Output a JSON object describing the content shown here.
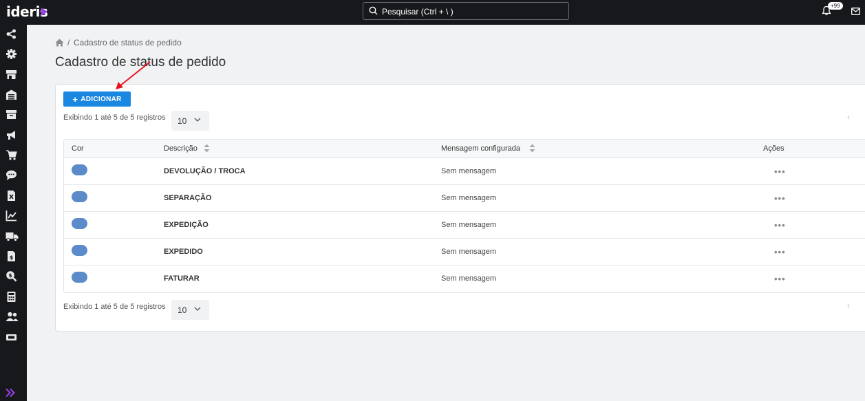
{
  "app": {
    "logo_text": "ideris",
    "search_placeholder": "Pesquisar (Ctrl + \\ )",
    "notifications_badge": "+99",
    "brand_color": "#9b3fe8"
  },
  "sidebar": {
    "icons": [
      "share-icon",
      "gear-icon",
      "store-icon",
      "warehouse-icon",
      "archive-icon",
      "megaphone-icon",
      "cart-icon",
      "chat-icon",
      "excel-file-icon",
      "chart-line-icon",
      "truck-icon",
      "invoice-icon",
      "search-dollar-icon",
      "calculator-icon",
      "users-icon",
      "ticket-icon"
    ],
    "expand_icon": "double-chevron-right-icon"
  },
  "breadcrumb": {
    "separator": "/",
    "current": "Cadastro de status de pedido"
  },
  "page": {
    "title": "Cadastro de status de pedido",
    "add_button": "ADICIONAR",
    "accent_color": "#1a88e0"
  },
  "listing": {
    "showing_top": "Exibindo 1 até 5 de 5 registros",
    "showing_bottom": "Exibindo 1 até 5 de 5 registros",
    "page_size": "10"
  },
  "table": {
    "headers": {
      "color": "Cor",
      "description": "Descrição",
      "message": "Mensagem configurada",
      "actions": "Ações"
    },
    "rows": [
      {
        "color": "#5b8bc9",
        "description": "DEVOLUÇÃO / TROCA",
        "message": "Sem mensagem",
        "actions": "•••"
      },
      {
        "color": "#5b8bc9",
        "description": "SEPARAÇÃO",
        "message": "Sem mensagem",
        "actions": "•••"
      },
      {
        "color": "#5b8bc9",
        "description": "EXPEDIÇÃO",
        "message": "Sem mensagem",
        "actions": "•••"
      },
      {
        "color": "#5b8bc9",
        "description": "EXPEDIDO",
        "message": "Sem mensagem",
        "actions": "•••"
      },
      {
        "color": "#5b8bc9",
        "description": "FATURAR",
        "message": "Sem mensagem",
        "actions": "•••"
      }
    ]
  },
  "pager": {
    "prev": "‹"
  }
}
